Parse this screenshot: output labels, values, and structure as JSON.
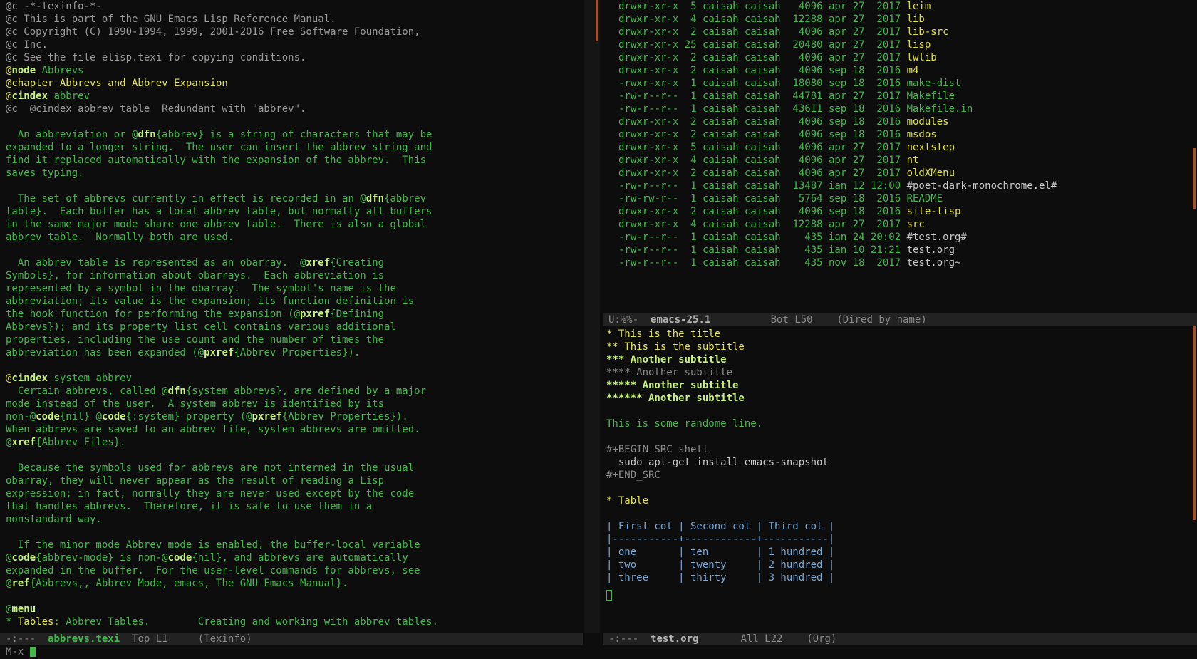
{
  "left_buffer": {
    "lines": [
      [
        [
          "@c -*-texinfo-*-",
          "grey"
        ]
      ],
      [
        [
          "@c This is part of the GNU Emacs Lisp Reference Manual.",
          "grey"
        ]
      ],
      [
        [
          "@c Copyright (C) 1990-1994, 1999, 2001-2016 Free Software Foundation,",
          "grey"
        ]
      ],
      [
        [
          "@c Inc.",
          "grey"
        ]
      ],
      [
        [
          "@c See the file elisp.texi for copying conditions.",
          "grey"
        ]
      ],
      [
        [
          "@",
          "yel"
        ],
        [
          "node",
          "kw"
        ],
        [
          " Abbrevs",
          "plain"
        ]
      ],
      [
        [
          "@chapter Abbrevs and Abbrev Expansion",
          "title"
        ]
      ],
      [
        [
          "@",
          "yel"
        ],
        [
          "cindex",
          "kw"
        ],
        [
          " abbrev",
          "plain"
        ]
      ],
      [
        [
          "@c  @cindex abbrev table  Redundant with \"abbrev\".",
          "grey"
        ]
      ],
      [
        [
          "",
          ""
        ]
      ],
      [
        [
          "  An abbreviation or @",
          "plain"
        ],
        [
          "dfn",
          "kw"
        ],
        [
          "{abbrev} is a string of characters that may be",
          "plain"
        ]
      ],
      [
        [
          "expanded to a longer string.  The user can insert the abbrev string and",
          "plain"
        ]
      ],
      [
        [
          "find it replaced automatically with the expansion of the abbrev.  This",
          "plain"
        ]
      ],
      [
        [
          "saves typing.",
          "plain"
        ]
      ],
      [
        [
          "",
          ""
        ]
      ],
      [
        [
          "  The set of abbrevs currently in effect is recorded in an @",
          "plain"
        ],
        [
          "dfn",
          "kw"
        ],
        [
          "{abbrev",
          "plain"
        ]
      ],
      [
        [
          "table}.  Each buffer has a local abbrev table, but normally all buffers",
          "plain"
        ]
      ],
      [
        [
          "in the same major mode share one abbrev table.  There is also a global",
          "plain"
        ]
      ],
      [
        [
          "abbrev table.  Normally both are used.",
          "plain"
        ]
      ],
      [
        [
          "",
          ""
        ]
      ],
      [
        [
          "  An abbrev table is represented as an obarray.  @",
          "plain"
        ],
        [
          "xref",
          "kw"
        ],
        [
          "{Creating",
          "plain"
        ]
      ],
      [
        [
          "Symbols}, for information about obarrays.  Each abbreviation is",
          "plain"
        ]
      ],
      [
        [
          "represented by a symbol in the obarray.  The symbol's name is the",
          "plain"
        ]
      ],
      [
        [
          "abbreviation; its value is the expansion; its function definition is",
          "plain"
        ]
      ],
      [
        [
          "the hook function for performing the expansion (@",
          "plain"
        ],
        [
          "pxref",
          "kw"
        ],
        [
          "{Defining",
          "plain"
        ]
      ],
      [
        [
          "Abbrevs}); and its property list cell contains various additional",
          "plain"
        ]
      ],
      [
        [
          "properties, including the use count and the number of times the",
          "plain"
        ]
      ],
      [
        [
          "abbreviation has been expanded (@",
          "plain"
        ],
        [
          "pxref",
          "kw"
        ],
        [
          "{Abbrev Properties}).",
          "plain"
        ]
      ],
      [
        [
          "",
          ""
        ]
      ],
      [
        [
          "@",
          "yel"
        ],
        [
          "cindex",
          "kw"
        ],
        [
          " system abbrev",
          "plain"
        ]
      ],
      [
        [
          "  Certain abbrevs, called @",
          "plain"
        ],
        [
          "dfn",
          "kw"
        ],
        [
          "{system abbrevs}, are defined by a major",
          "plain"
        ]
      ],
      [
        [
          "mode instead of the user.  A system abbrev is identified by its",
          "plain"
        ]
      ],
      [
        [
          "non-@",
          "plain"
        ],
        [
          "code",
          "kw"
        ],
        [
          "{nil} @",
          "plain"
        ],
        [
          "code",
          "kw"
        ],
        [
          "{:system} property (@",
          "plain"
        ],
        [
          "pxref",
          "kw"
        ],
        [
          "{Abbrev Properties}).",
          "plain"
        ]
      ],
      [
        [
          "When abbrevs are saved to an abbrev file, system abbrevs are omitted.",
          "plain"
        ]
      ],
      [
        [
          "@",
          "plain"
        ],
        [
          "xref",
          "kw"
        ],
        [
          "{Abbrev Files}.",
          "plain"
        ]
      ],
      [
        [
          "",
          ""
        ]
      ],
      [
        [
          "  Because the symbols used for abbrevs are not interned in the usual",
          "plain"
        ]
      ],
      [
        [
          "obarray, they will never appear as the result of reading a Lisp",
          "plain"
        ]
      ],
      [
        [
          "expression; in fact, normally they are never used except by the code",
          "plain"
        ]
      ],
      [
        [
          "that handles abbrevs.  Therefore, it is safe to use them in a",
          "plain"
        ]
      ],
      [
        [
          "nonstandard way.",
          "plain"
        ]
      ],
      [
        [
          "",
          ""
        ]
      ],
      [
        [
          "  If the minor mode Abbrev mode is enabled, the buffer-local variable",
          "plain"
        ]
      ],
      [
        [
          "@",
          "plain"
        ],
        [
          "code",
          "kw"
        ],
        [
          "{abbrev-mode} is non-@",
          "plain"
        ],
        [
          "code",
          "kw"
        ],
        [
          "{nil}, and abbrevs are automatically",
          "plain"
        ]
      ],
      [
        [
          "expanded in the buffer.  For the user-level commands for abbrevs, see",
          "plain"
        ]
      ],
      [
        [
          "@",
          "plain"
        ],
        [
          "ref",
          "kw"
        ],
        [
          "{Abbrevs,, Abbrev Mode, emacs, The GNU Emacs Manual}.",
          "plain"
        ]
      ],
      [
        [
          "",
          ""
        ]
      ],
      [
        [
          "@",
          "plain"
        ],
        [
          "menu",
          "kw"
        ]
      ],
      [
        [
          "* ",
          "plain"
        ],
        [
          "Tables",
          "title"
        ],
        [
          ": Abbrev Tables.        Creating and working with abbrev tables.",
          "plain"
        ]
      ]
    ]
  },
  "dired": {
    "rows": [
      {
        "perm": "drwxr-xr-x",
        "links": "5",
        "owner": "caisah",
        "group": "caisah",
        "size": "4096",
        "month": "apr",
        "day": "27",
        "time": "2017",
        "name": "leim",
        "kind": "dir"
      },
      {
        "perm": "drwxr-xr-x",
        "links": "4",
        "owner": "caisah",
        "group": "caisah",
        "size": "12288",
        "month": "apr",
        "day": "27",
        "time": "2017",
        "name": "lib",
        "kind": "dir"
      },
      {
        "perm": "drwxr-xr-x",
        "links": "2",
        "owner": "caisah",
        "group": "caisah",
        "size": "4096",
        "month": "apr",
        "day": "27",
        "time": "2017",
        "name": "lib-src",
        "kind": "dir"
      },
      {
        "perm": "drwxr-xr-x",
        "links": "25",
        "owner": "caisah",
        "group": "caisah",
        "size": "20480",
        "month": "apr",
        "day": "27",
        "time": "2017",
        "name": "lisp",
        "kind": "dir"
      },
      {
        "perm": "drwxr-xr-x",
        "links": "2",
        "owner": "caisah",
        "group": "caisah",
        "size": "4096",
        "month": "apr",
        "day": "27",
        "time": "2017",
        "name": "lwlib",
        "kind": "dir"
      },
      {
        "perm": "drwxr-xr-x",
        "links": "2",
        "owner": "caisah",
        "group": "caisah",
        "size": "4096",
        "month": "sep",
        "day": "18",
        "time": "2016",
        "name": "m4",
        "kind": "dir"
      },
      {
        "perm": "-rwxr-xr-x",
        "links": "1",
        "owner": "caisah",
        "group": "caisah",
        "size": "18080",
        "month": "sep",
        "day": "18",
        "time": "2016",
        "name": "make-dist",
        "kind": "file"
      },
      {
        "perm": "-rw-r--r--",
        "links": "1",
        "owner": "caisah",
        "group": "caisah",
        "size": "44781",
        "month": "apr",
        "day": "27",
        "time": "2017",
        "name": "Makefile",
        "kind": "file"
      },
      {
        "perm": "-rw-r--r--",
        "links": "1",
        "owner": "caisah",
        "group": "caisah",
        "size": "43611",
        "month": "sep",
        "day": "18",
        "time": "2016",
        "name": "Makefile.in",
        "kind": "file"
      },
      {
        "perm": "drwxr-xr-x",
        "links": "2",
        "owner": "caisah",
        "group": "caisah",
        "size": "4096",
        "month": "sep",
        "day": "18",
        "time": "2016",
        "name": "modules",
        "kind": "dir"
      },
      {
        "perm": "drwxr-xr-x",
        "links": "2",
        "owner": "caisah",
        "group": "caisah",
        "size": "4096",
        "month": "sep",
        "day": "18",
        "time": "2016",
        "name": "msdos",
        "kind": "dir"
      },
      {
        "perm": "drwxr-xr-x",
        "links": "5",
        "owner": "caisah",
        "group": "caisah",
        "size": "4096",
        "month": "apr",
        "day": "27",
        "time": "2017",
        "name": "nextstep",
        "kind": "dir"
      },
      {
        "perm": "drwxr-xr-x",
        "links": "4",
        "owner": "caisah",
        "group": "caisah",
        "size": "4096",
        "month": "apr",
        "day": "27",
        "time": "2017",
        "name": "nt",
        "kind": "dir"
      },
      {
        "perm": "drwxr-xr-x",
        "links": "2",
        "owner": "caisah",
        "group": "caisah",
        "size": "4096",
        "month": "apr",
        "day": "27",
        "time": "2017",
        "name": "oldXMenu",
        "kind": "dir"
      },
      {
        "perm": "-rw-r--r--",
        "links": "1",
        "owner": "caisah",
        "group": "caisah",
        "size": "13487",
        "month": "ian",
        "day": "12",
        "time": "12:00",
        "name": "#poet-dark-monochrome.el#",
        "kind": "wfile"
      },
      {
        "perm": "-rw-rw-r--",
        "links": "1",
        "owner": "caisah",
        "group": "caisah",
        "size": "5764",
        "month": "sep",
        "day": "18",
        "time": "2016",
        "name": "README",
        "kind": "file"
      },
      {
        "perm": "drwxr-xr-x",
        "links": "2",
        "owner": "caisah",
        "group": "caisah",
        "size": "4096",
        "month": "sep",
        "day": "18",
        "time": "2016",
        "name": "site-lisp",
        "kind": "dir"
      },
      {
        "perm": "drwxr-xr-x",
        "links": "4",
        "owner": "caisah",
        "group": "caisah",
        "size": "12288",
        "month": "apr",
        "day": "27",
        "time": "2017",
        "name": "src",
        "kind": "dir"
      },
      {
        "perm": "-rw-r--r--",
        "links": "1",
        "owner": "caisah",
        "group": "caisah",
        "size": "435",
        "month": "ian",
        "day": "24",
        "time": "20:02",
        "name": "#test.org#",
        "kind": "wfile"
      },
      {
        "perm": "-rw-r--r--",
        "links": "1",
        "owner": "caisah",
        "group": "caisah",
        "size": "435",
        "month": "ian",
        "day": "10",
        "time": "21:21",
        "name": "test.org",
        "kind": "wfile"
      },
      {
        "perm": "-rw-r--r--",
        "links": "1",
        "owner": "caisah",
        "group": "caisah",
        "size": "435",
        "month": "nov",
        "day": "18",
        "time": "2017",
        "name": "test.org~",
        "kind": "wfile"
      }
    ]
  },
  "org": {
    "lines": [
      [
        [
          "* This is the title",
          "h1"
        ]
      ],
      [
        [
          "** This is the subtitle",
          "h2"
        ]
      ],
      [
        [
          "*** Another subtitle",
          "h3"
        ]
      ],
      [
        [
          "**** Another subtitle",
          "h4"
        ]
      ],
      [
        [
          "***** Another subtitle",
          "h5"
        ]
      ],
      [
        [
          "****** Another subtitle",
          "h6"
        ]
      ],
      [
        [
          "",
          ""
        ]
      ],
      [
        [
          "This is some randome line.",
          "plain"
        ]
      ],
      [
        [
          "",
          ""
        ]
      ],
      [
        [
          "#+BEGIN_SRC shell",
          "meta"
        ]
      ],
      [
        [
          "  sudo apt-get install emacs-snapshot",
          "src"
        ]
      ],
      [
        [
          "#+END_SRC",
          "meta"
        ]
      ],
      [
        [
          "",
          ""
        ]
      ],
      [
        [
          "* Table",
          "h1"
        ]
      ],
      [
        [
          "",
          ""
        ]
      ],
      [
        [
          "| First col | Second col | Third col |",
          "table"
        ]
      ],
      [
        [
          "|-----------+------------+-----------|",
          "table"
        ]
      ],
      [
        [
          "| one       | ten        | 1 hundred |",
          "table"
        ]
      ],
      [
        [
          "| two       | twenty     | 2 hundred |",
          "table"
        ]
      ],
      [
        [
          "| three     | thirty     | 3 hundred |",
          "table"
        ]
      ]
    ]
  },
  "modelines": {
    "left": {
      "state": "-:---",
      "buffer": "abbrevs.texi",
      "pos": "Top L1",
      "mode": "(Texinfo)"
    },
    "right_top": {
      "state": "U:%%-",
      "buffer": "emacs-25.1",
      "pos": "Bot L50",
      "mode": "(Dired by name)"
    },
    "right_bottom": {
      "state": "-:---",
      "buffer": "test.org",
      "pos": "All L22",
      "mode": "(Org)"
    }
  },
  "minibuffer": {
    "prompt": "M-x"
  },
  "colors": {
    "foreground": "#41b949",
    "background": "#0d0d0d",
    "accent": "#c8f27a",
    "scrollbar": "#a0522d"
  }
}
